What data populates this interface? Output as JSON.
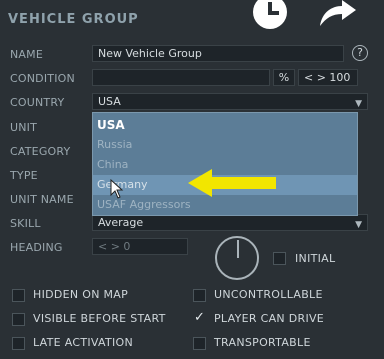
{
  "window": {
    "title": "VEHICLE GROUP"
  },
  "toolbar": {
    "history_icon": "clock-icon",
    "forward_icon": "share-arrow-icon"
  },
  "form": {
    "name_label": "NAME",
    "name_value": "New Vehicle Group",
    "help_label": "?",
    "condition_label": "CONDITION",
    "condition_unit": "%",
    "condition_value": "< > 100",
    "country_label": "COUNTRY",
    "country_value": "USA",
    "unit_label": "UNIT",
    "category_label": "CATEGORY",
    "type_label": "TYPE",
    "unit_name_label": "UNIT NAME",
    "skill_label": "SKILL",
    "skill_value": "Average",
    "heading_label": "HEADING",
    "heading_value": "< > 0",
    "initial_label": "INITIAL"
  },
  "dropdown": {
    "options": [
      "USA",
      "Russia",
      "China",
      "Germany",
      "USAF Aggressors"
    ],
    "selected": "USA",
    "hovered": "Germany"
  },
  "checkboxes": {
    "hidden_on_map": {
      "label": "HIDDEN ON MAP",
      "checked": false
    },
    "uncontrollable": {
      "label": "UNCONTROLLABLE",
      "checked": false
    },
    "visible_before_start": {
      "label": "VISIBLE BEFORE START",
      "checked": false
    },
    "player_can_drive": {
      "label": "PLAYER CAN DRIVE",
      "checked": true
    },
    "late_activation": {
      "label": "LATE ACTIVATION",
      "checked": false
    },
    "transportable": {
      "label": "TRANSPORTABLE",
      "checked": false
    }
  },
  "colors": {
    "background": "#2a3035",
    "dropdown": "#5c7d97",
    "hover": "#6f95b4",
    "arrow": "#f2e600"
  }
}
